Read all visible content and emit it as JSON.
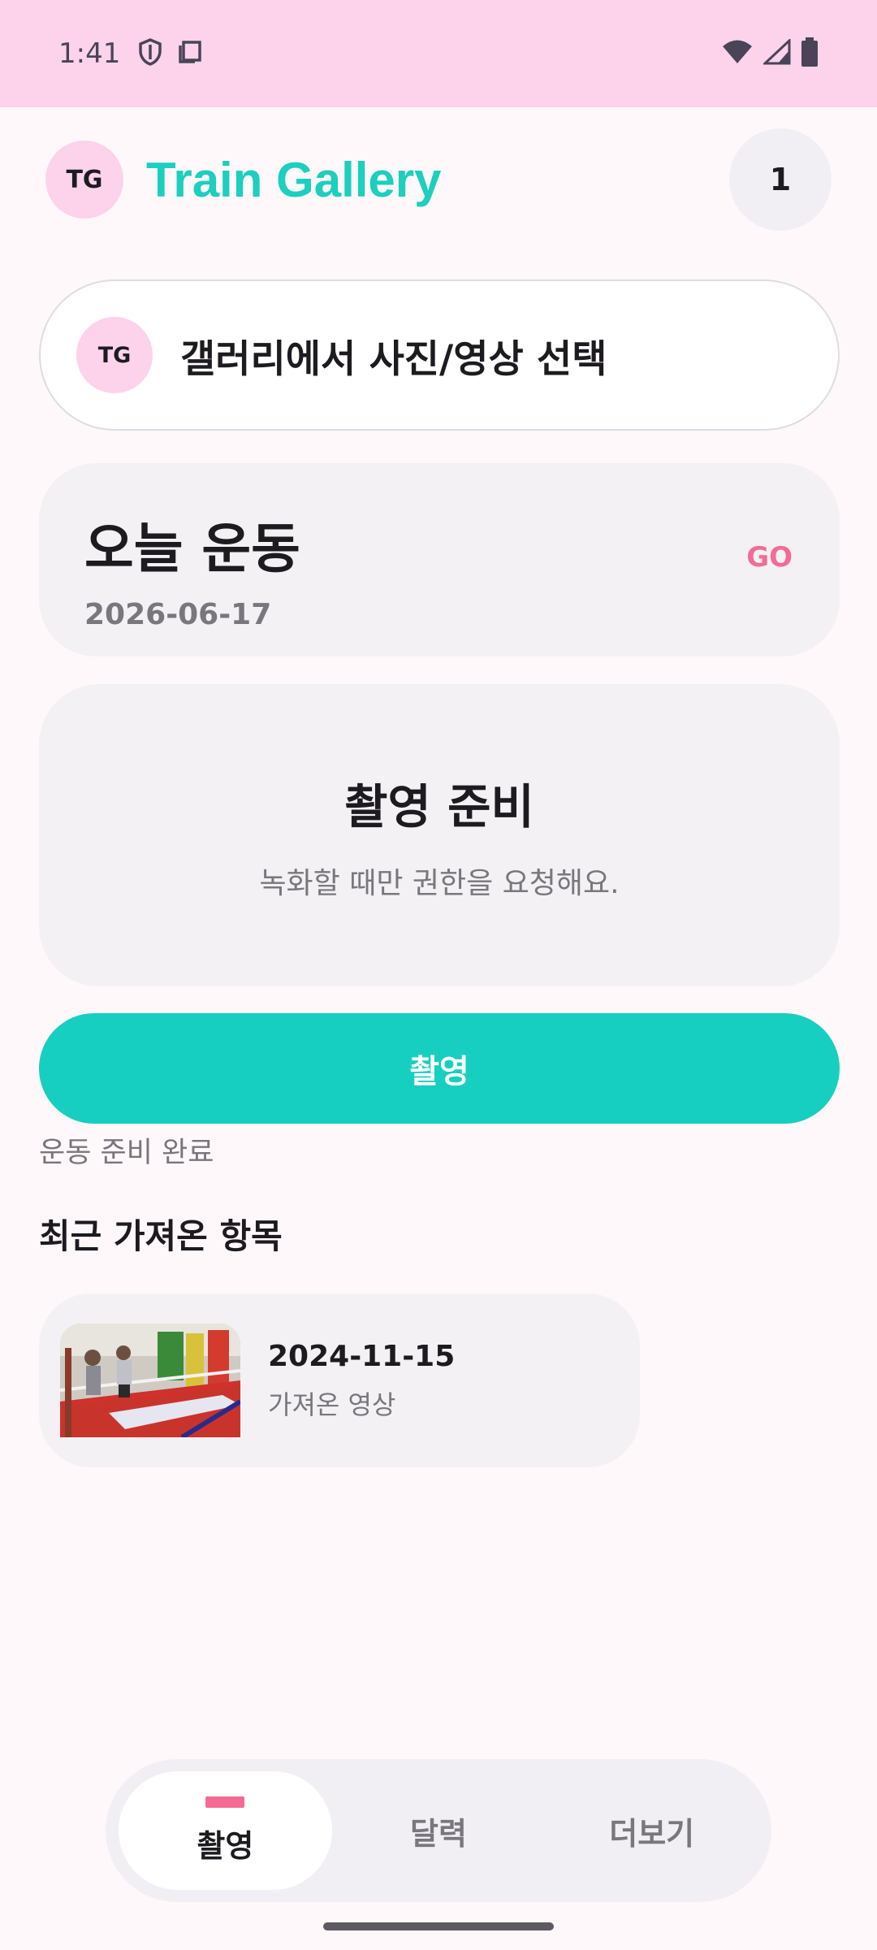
{
  "status_bar": {
    "time": "1:41",
    "icons": [
      "shield-icon",
      "screenshot-icon",
      "wifi-icon",
      "signal-icon",
      "battery-icon"
    ]
  },
  "header": {
    "logo_text": "TG",
    "title": "Train Gallery",
    "count": "1"
  },
  "gallery_card": {
    "logo_text": "TG",
    "label": "갤러리에서 사진/영상 선택"
  },
  "today_card": {
    "title": "오늘 운동",
    "date": "2026-06-17",
    "go_label": "GO"
  },
  "ready_card": {
    "title": "촬영 준비",
    "subtitle": "녹화할 때만 권한을 요청해요."
  },
  "shoot_button": {
    "label": "촬영"
  },
  "ready_status": "운동 준비 완료",
  "recent": {
    "heading": "최근 가져온 항목",
    "items": [
      {
        "date": "2024-11-15",
        "type": "가져온 영상"
      }
    ]
  },
  "bottom_nav": {
    "items": [
      {
        "label": "촬영",
        "active": true
      },
      {
        "label": "달력",
        "active": false
      },
      {
        "label": "더보기",
        "active": false
      }
    ]
  },
  "colors": {
    "accent_teal": "#17cfc0",
    "accent_pink": "#f46c94",
    "status_bar_bg": "#fcd3ea"
  }
}
